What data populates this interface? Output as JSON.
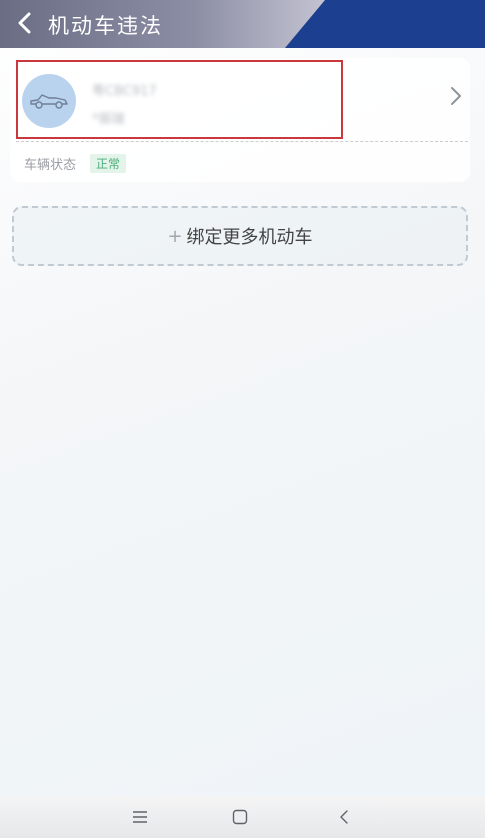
{
  "header": {
    "title": "机动车违法"
  },
  "vehicle": {
    "plate": "粤CBC917",
    "owner": "*振瑞",
    "status_label": "车辆状态",
    "status_value": "正常"
  },
  "bind_more": {
    "plus": "+",
    "label": "绑定更多机动车"
  },
  "colors": {
    "header_blue": "#1d3f8f",
    "avatar_bg": "#b9d2ee",
    "highlight_red": "#c8383d",
    "status_green": "#4cae7a"
  },
  "icons": {
    "back": "back-arrow-icon",
    "car": "car-icon",
    "chevron": "chevron-right-icon",
    "menu": "menu-icon",
    "home": "home-icon",
    "nav_back": "nav-back-icon"
  }
}
